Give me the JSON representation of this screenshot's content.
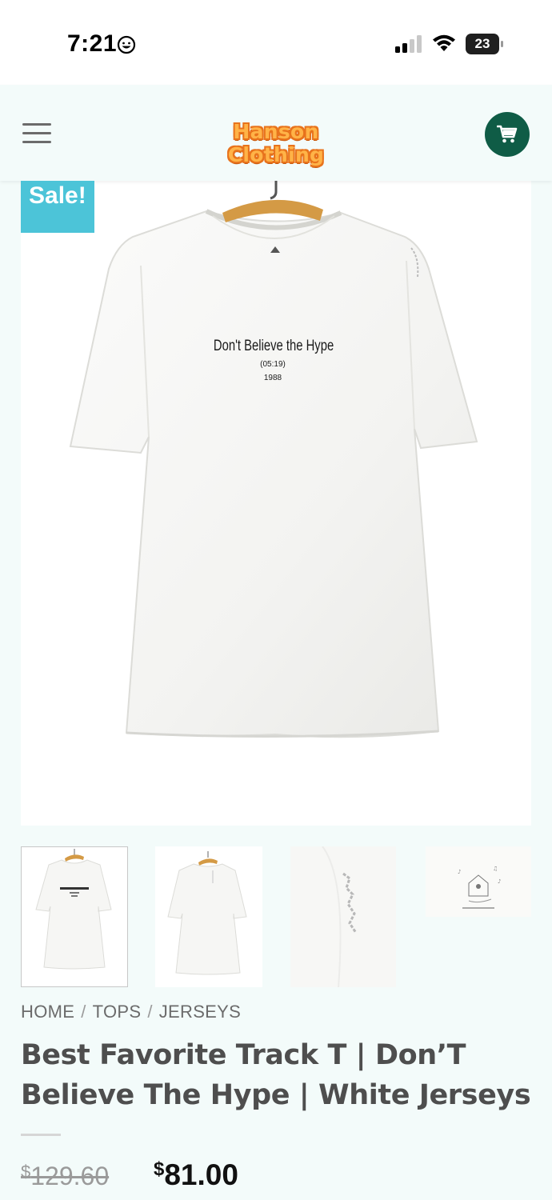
{
  "status_bar": {
    "time": "7:21",
    "battery": "23",
    "icons": [
      "smiley-icon",
      "signal-icon",
      "wifi-icon",
      "battery-icon"
    ]
  },
  "header": {
    "menu_icon": "hamburger-menu-icon",
    "logo_text": "Hanson Clothing",
    "cart_icon": "shopping-cart-icon",
    "cart_color": "#0f5c46"
  },
  "product_image": {
    "sale_badge": "Sale!",
    "sale_color": "#4cc4d8",
    "print_title": "Don't Believe the Hype",
    "print_subtitle": "(05:19)",
    "print_year": "1988"
  },
  "thumbnails": [
    {
      "name": "front view"
    },
    {
      "name": "back view"
    },
    {
      "name": "sleeve detail"
    },
    {
      "name": "back print detail"
    }
  ],
  "breadcrumb": {
    "items": [
      "HOME",
      "TOPS",
      "JERSEYS"
    ],
    "separator": "/"
  },
  "product": {
    "title": "Best Favorite Track T | Don’T Believe The Hype | White Jerseys",
    "price_old_currency": "$",
    "price_old": "129.60",
    "price_new_currency": "$",
    "price_new": "81.00"
  }
}
